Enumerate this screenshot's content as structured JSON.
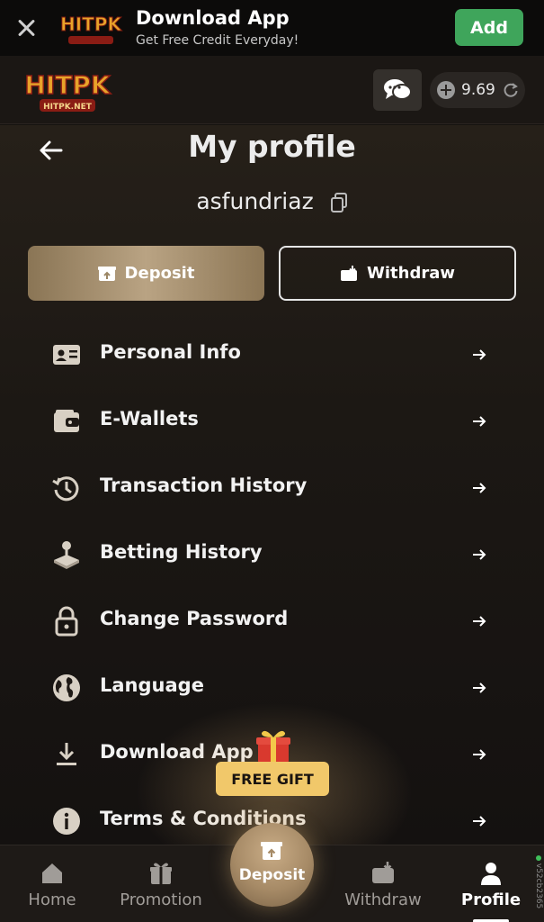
{
  "banner": {
    "title": "Download App",
    "subtitle": "Get Free Credit Everyday!",
    "add_label": "Add",
    "logo_text": "HITPK"
  },
  "header": {
    "logo_text": "HITPK",
    "logo_sub": "HITPK.NET",
    "balance": "9.69"
  },
  "profile": {
    "title": "My profile",
    "username": "asfundriaz",
    "deposit_label": "Deposit",
    "withdraw_label": "Withdraw"
  },
  "menu": [
    {
      "label": "Personal Info",
      "icon": "id-card-icon"
    },
    {
      "label": "E-Wallets",
      "icon": "wallet-icon"
    },
    {
      "label": "Transaction History",
      "icon": "history-icon"
    },
    {
      "label": "Betting History",
      "icon": "joystick-icon"
    },
    {
      "label": "Change Password",
      "icon": "lock-icon"
    },
    {
      "label": "Language",
      "icon": "globe-icon"
    },
    {
      "label": "Download App",
      "icon": "download-icon"
    },
    {
      "label": "Terms & Conditions",
      "icon": "info-icon"
    }
  ],
  "promo": {
    "free_gift_label": "FREE GIFT"
  },
  "nav": {
    "home": "Home",
    "promotion": "Promotion",
    "deposit": "Deposit",
    "withdraw": "Withdraw",
    "profile": "Profile"
  },
  "version": "v52cb2365",
  "colors": {
    "accent_gold": "#b9a383",
    "add_green": "#3fa55b",
    "gift_yellow": "#f1c86a"
  }
}
